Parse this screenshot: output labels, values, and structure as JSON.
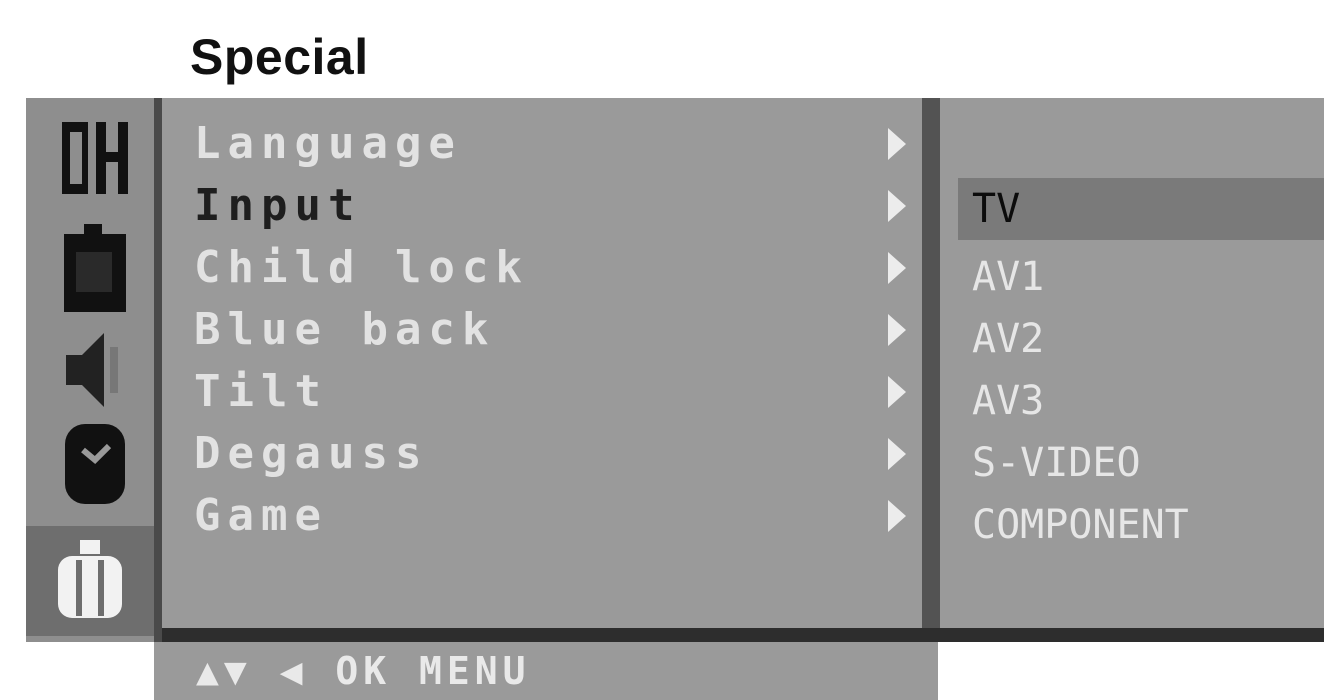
{
  "header": {
    "title": "Special"
  },
  "sidebar": {
    "icons": [
      {
        "name": "channel-icon",
        "label": "CH"
      },
      {
        "name": "picture-icon"
      },
      {
        "name": "sound-icon"
      },
      {
        "name": "timer-icon"
      },
      {
        "name": "special-icon",
        "selected": true
      }
    ]
  },
  "menu": {
    "items": [
      {
        "label": "Language"
      },
      {
        "label": "Input",
        "active": true
      },
      {
        "label": "Child lock"
      },
      {
        "label": "Blue back"
      },
      {
        "label": "Tilt"
      },
      {
        "label": "Degauss"
      },
      {
        "label": "Game"
      }
    ]
  },
  "submenu": {
    "items": [
      {
        "label": "TV",
        "selected": true
      },
      {
        "label": "AV1"
      },
      {
        "label": "AV2"
      },
      {
        "label": "AV3"
      },
      {
        "label": "S-VIDEO"
      },
      {
        "label": "COMPONENT"
      }
    ]
  },
  "footer": {
    "hints": "▲▼ ◀ OK MENU"
  },
  "colors": {
    "panel": "#9a9a9a",
    "highlight": "#7a7a7a",
    "text": "#e6e6e6",
    "active_text": "#1e1e1e"
  }
}
